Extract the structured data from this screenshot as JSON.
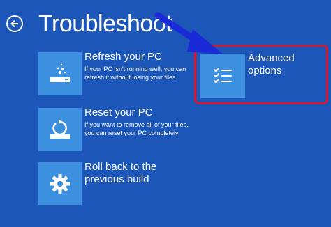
{
  "header": {
    "title": "Troubleshoot"
  },
  "options": [
    {
      "label": "Refresh your PC",
      "description": "If your PC isn't running well, you can refresh it without losing your files",
      "icon": "refresh-pc-icon"
    },
    {
      "label": "Reset your PC",
      "description": "If you want to remove all of your files, you can reset your PC completely",
      "icon": "reset-pc-icon"
    },
    {
      "label": "Roll back to the previous build",
      "description": "",
      "icon": "gear-icon"
    },
    {
      "label": "Advanced options",
      "description": "",
      "icon": "checklist-icon"
    }
  ],
  "annotations": {
    "highlight_color": "#d9172c",
    "arrow_color": "#1a2ad8"
  },
  "colors": {
    "background": "#1c56b8",
    "tile": "#3d8fe0"
  }
}
